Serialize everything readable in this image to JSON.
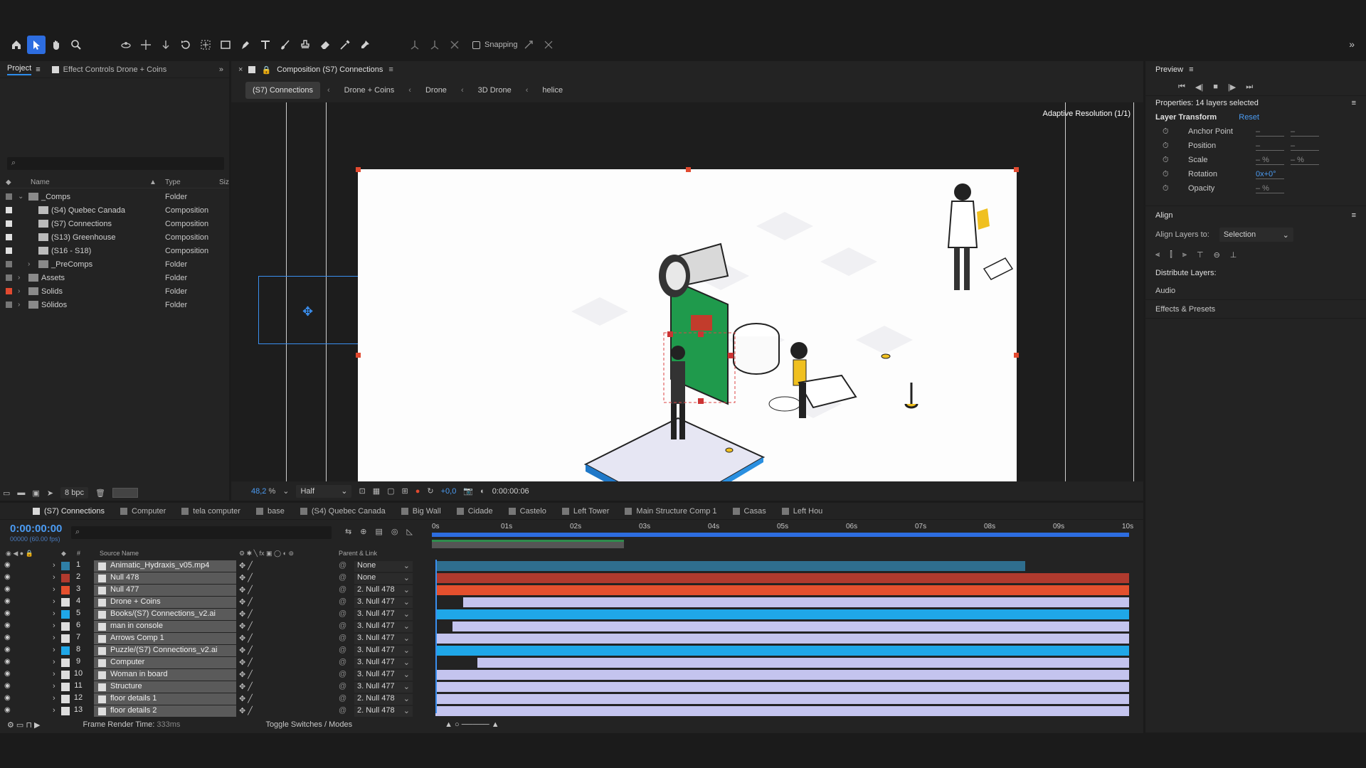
{
  "colors": {
    "accent": "#2d8ceb",
    "timecode": "#4b9bf2",
    "label_red": "#e24a30",
    "label_blue": "#2f9be0",
    "track_lavender": "#c4c4ee",
    "track_blue": "#1fa7e8",
    "track_red": "#b03a2e",
    "track_orange": "#e5502e",
    "track_teal": "#2f7fa7",
    "canvas_green": "#1f9a4c"
  },
  "toolbar": {
    "snapping_label": "Snapping",
    "tools": [
      "home-icon",
      "selection-tool-icon",
      "hand-tool-icon",
      "zoom-tool-icon",
      "orbit-tool-icon",
      "pan-tool-icon",
      "dolly-tool-icon",
      "rotate-tool-icon",
      "pan-behind-tool-icon",
      "rectangle-tool-icon",
      "pen-tool-icon",
      "text-tool-icon",
      "brush-tool-icon",
      "clone-stamp-icon",
      "eraser-icon",
      "roto-brush-icon",
      "puppet-pin-icon"
    ]
  },
  "project_panel": {
    "tabs": [
      {
        "label": "Project"
      },
      {
        "label": "Effect Controls Drone + Coins"
      }
    ],
    "search_placeholder": "",
    "columns": {
      "name": "Name",
      "type": "Type",
      "size": "Siz"
    },
    "items": [
      {
        "name": "_Comps",
        "type": "Folder",
        "kind": "folder",
        "expanded": true,
        "label_color": "#777777",
        "indent": 0
      },
      {
        "name": "(S4) Quebec Canada",
        "type": "Composition",
        "kind": "comp",
        "label_color": "#e0e0e0",
        "indent": 1
      },
      {
        "name": "(S7) Connections",
        "type": "Composition",
        "kind": "comp",
        "label_color": "#e0e0e0",
        "indent": 1
      },
      {
        "name": "(S13) Greenhouse",
        "type": "Composition",
        "kind": "comp",
        "label_color": "#e0e0e0",
        "indent": 1
      },
      {
        "name": "(S16 - S18)",
        "type": "Composition",
        "kind": "comp",
        "label_color": "#e0e0e0",
        "indent": 1
      },
      {
        "name": "_PreComps",
        "type": "Folder",
        "kind": "folder",
        "expanded": false,
        "label_color": "#777777",
        "indent": 1
      },
      {
        "name": "Assets",
        "type": "Folder",
        "kind": "folder",
        "expanded": false,
        "label_color": "#777777",
        "indent": 0
      },
      {
        "name": "Solids",
        "type": "Folder",
        "kind": "folder",
        "expanded": false,
        "label_color": "#e24a30",
        "indent": 0
      },
      {
        "name": "Sólidos",
        "type": "Folder",
        "kind": "folder",
        "expanded": false,
        "label_color": "#777777",
        "indent": 0
      }
    ],
    "footer_bpc": "8 bpc"
  },
  "composition_panel": {
    "tab_label": "Composition (S7) Connections",
    "breadcrumbs": [
      "(S7) Connections",
      "Drone + Coins",
      "Drone",
      "3D Drone",
      "helice"
    ],
    "adaptive_label": "Adaptive Resolution (1/1)",
    "zoom": "48,2",
    "zoom_unit": "%",
    "quality": "Half",
    "exposure": "+0,0",
    "timecode": "0:00:00:06"
  },
  "preview_panel": {
    "title": "Preview",
    "controls": [
      "first-frame-icon",
      "prev-frame-icon",
      "stop-icon",
      "next-frame-icon",
      "last-frame-icon"
    ]
  },
  "properties_panel": {
    "title": "Properties: 14 layers selected",
    "section": "Layer Transform",
    "reset": "Reset",
    "props": [
      {
        "name": "Anchor Point",
        "v1": "–",
        "v2": "–"
      },
      {
        "name": "Position",
        "v1": "–",
        "v2": "–"
      },
      {
        "name": "Scale",
        "v1": "– %",
        "v2": "– %"
      },
      {
        "name": "Rotation",
        "v1": "0x+0°",
        "v2": ""
      },
      {
        "name": "Opacity",
        "v1": "– %",
        "v2": ""
      }
    ]
  },
  "align_panel": {
    "title": "Align",
    "align_to_label": "Align Layers to:",
    "align_to_value": "Selection",
    "distribute_label": "Distribute Layers:",
    "links": [
      "Audio",
      "Effects & Presets"
    ]
  },
  "timeline": {
    "tabs": [
      "(S7) Connections",
      "Computer",
      "tela computer",
      "base",
      "(S4) Quebec Canada",
      "Big Wall",
      "Cidade",
      "Castelo",
      "Left Tower",
      "Main Structure Comp 1",
      "Casas",
      "Left Hou"
    ],
    "timecode": "0:00:00:00",
    "fps": "00000 (60.00 fps)",
    "col_source": "Source Name",
    "col_parent": "Parent & Link",
    "ruler": [
      "0s",
      "01s",
      "02s",
      "03s",
      "04s",
      "05s",
      "06s",
      "07s",
      "08s",
      "09s",
      "10s"
    ],
    "layers": [
      {
        "idx": "1",
        "name": "Animatic_Hydraxis_v05.mp4",
        "label": "#2f7fa7",
        "parent": "None",
        "track_start": 0.0,
        "track_end": 0.85,
        "track_color": "#2f6e8e"
      },
      {
        "idx": "2",
        "name": "Null 478",
        "label": "#b03a2e",
        "parent": "None",
        "track_start": 0.0,
        "track_end": 1.0,
        "track_color": "#b03a2e"
      },
      {
        "idx": "3",
        "name": "Null 477",
        "label": "#e5502e",
        "parent": "2. Null 478",
        "track_start": 0.0,
        "track_end": 1.0,
        "track_color": "#e5502e"
      },
      {
        "idx": "4",
        "name": "Drone + Coins",
        "label": "#dddddd",
        "parent": "3. Null 477",
        "track_start": 0.04,
        "track_end": 1.0,
        "track_color": "#c4c4ee"
      },
      {
        "idx": "5",
        "name": "Books/(S7) Connections_v2.ai",
        "label": "#1fa7e8",
        "parent": "3. Null 477",
        "track_start": 0.0,
        "track_end": 1.0,
        "track_color": "#1fa7e8"
      },
      {
        "idx": "6",
        "name": "man in console",
        "label": "#dddddd",
        "parent": "3. Null 477",
        "track_start": 0.025,
        "track_end": 1.0,
        "track_color": "#c4c4ee"
      },
      {
        "idx": "7",
        "name": "Arrows Comp 1",
        "label": "#dddddd",
        "parent": "3. Null 477",
        "track_start": 0.0,
        "track_end": 1.0,
        "track_color": "#c4c4ee"
      },
      {
        "idx": "8",
        "name": "Puzzle/(S7) Connections_v2.ai",
        "label": "#1fa7e8",
        "parent": "3. Null 477",
        "track_start": 0.0,
        "track_end": 1.0,
        "track_color": "#1fa7e8"
      },
      {
        "idx": "9",
        "name": "Computer",
        "label": "#dddddd",
        "parent": "3. Null 477",
        "track_start": 0.06,
        "track_end": 1.0,
        "track_color": "#c4c4ee"
      },
      {
        "idx": "10",
        "name": "Woman in board",
        "label": "#dddddd",
        "parent": "3. Null 477",
        "track_start": 0.0,
        "track_end": 1.0,
        "track_color": "#c4c4ee"
      },
      {
        "idx": "11",
        "name": "Structure",
        "label": "#dddddd",
        "parent": "3. Null 477",
        "track_start": 0.0,
        "track_end": 1.0,
        "track_color": "#c4c4ee"
      },
      {
        "idx": "12",
        "name": "floor details 1",
        "label": "#dddddd",
        "parent": "2. Null 478",
        "track_start": 0.0,
        "track_end": 1.0,
        "track_color": "#c4c4ee"
      },
      {
        "idx": "13",
        "name": "floor details 2",
        "label": "#dddddd",
        "parent": "2. Null 478",
        "track_start": 0.0,
        "track_end": 1.0,
        "track_color": "#c4c4ee"
      }
    ],
    "frame_render_label": "Frame Render Time:",
    "frame_render_value": "333ms",
    "toggle_label": "Toggle Switches / Modes"
  }
}
